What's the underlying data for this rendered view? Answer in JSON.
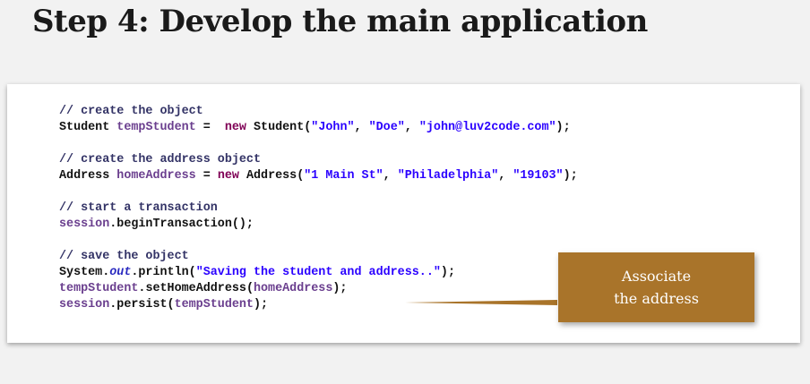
{
  "slide": {
    "title": "Step 4: Develop the main application"
  },
  "code": {
    "c1": "// create the object",
    "l1a": "Student ",
    "l1b": "tempStudent",
    "l1c": " =  ",
    "l1d": "new",
    "l1e": " Student(",
    "l1f": "\"John\"",
    "l1g": ", ",
    "l1h": "\"Doe\"",
    "l1i": ", ",
    "l1j": "\"john@luv2code.com\"",
    "l1k": ");",
    "c2": "// create the address object",
    "l2a": "Address ",
    "l2b": "homeAddress",
    "l2c": " = ",
    "l2d": "new",
    "l2e": " Address(",
    "l2f": "\"1 Main St\"",
    "l2g": ", ",
    "l2h": "\"Philadelphia\"",
    "l2i": ", ",
    "l2j": "\"19103\"",
    "l2k": ");",
    "c3": "// start a transaction",
    "l3a": "session",
    "l3b": ".beginTransaction();",
    "c4": "// save the object",
    "l4a": "System.",
    "l4b": "out",
    "l4c": ".println(",
    "l4d": "\"Saving the student and address..\"",
    "l4e": ");",
    "l5a": "tempStudent",
    "l5b": ".setHomeAddress(",
    "l5c": "homeAddress",
    "l5d": ");",
    "l6a": "session",
    "l6b": ".persist(",
    "l6c": "tempStudent",
    "l6d": ");"
  },
  "callout": {
    "text": "Associate\nthe address",
    "color": "#a9742a"
  }
}
